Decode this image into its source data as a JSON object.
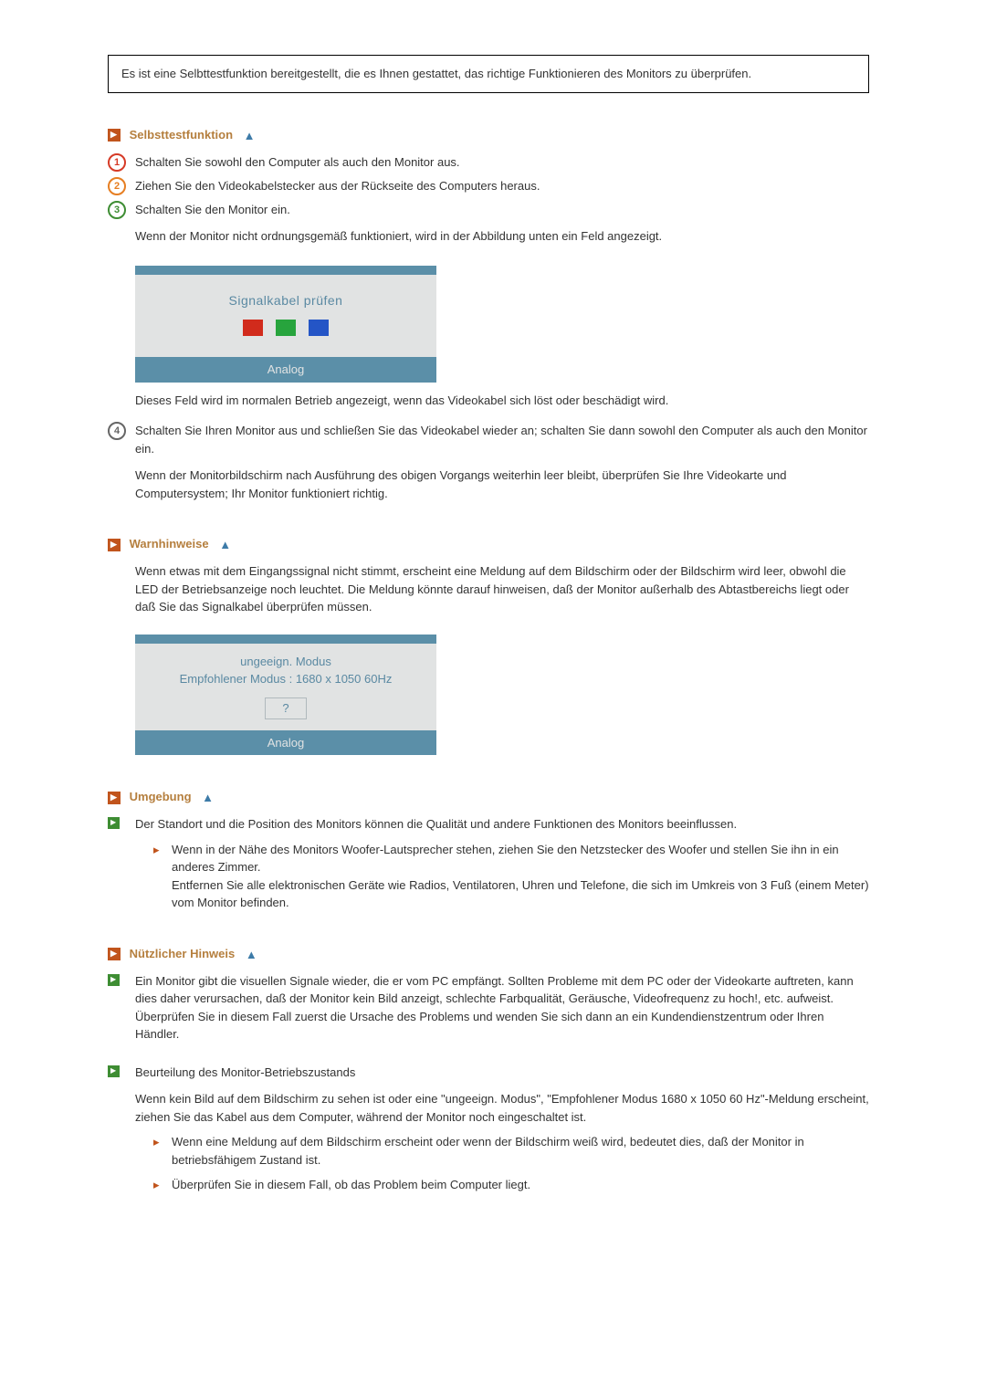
{
  "intro": "Es ist eine Selbttestfunktion bereitgestellt, die es Ihnen gestattet, das richtige Funktionieren des Monitors zu überprüfen.",
  "sec1": {
    "title": "Selbsttestfunktion",
    "items": {
      "i1": "Schalten Sie sowohl den Computer als auch den Monitor aus.",
      "i2": "Ziehen Sie den Videokabelstecker aus der Rückseite des Computers heraus.",
      "i3": "Schalten Sie den Monitor ein.",
      "i3_sub": "Wenn der Monitor nicht ordnungsgemäß funktioniert, wird in der Abbildung unten ein Feld angezeigt.",
      "osd_title": "Signalkabel prüfen",
      "osd_bottom": "Analog",
      "i3_after": "Dieses Feld wird im normalen Betrieb angezeigt, wenn das Videokabel sich löst oder beschädigt wird.",
      "i4": "Schalten Sie Ihren Monitor aus und schließen Sie das Videokabel wieder an; schalten Sie dann sowohl den Computer als auch den Monitor ein.",
      "i4_sub": "Wenn der Monitorbildschirm nach Ausführung des obigen Vorgangs weiterhin leer bleibt, überprüfen Sie Ihre Videokarte und Computersystem; Ihr Monitor funktioniert richtig."
    }
  },
  "sec2": {
    "title": "Warnhinweise",
    "body": "Wenn etwas mit dem Eingangssignal nicht stimmt, erscheint eine Meldung auf dem Bildschirm oder der Bildschirm wird leer, obwohl die LED der Betriebsanzeige noch leuchtet. Die Meldung könnte darauf hinweisen, daß der Monitor außerhalb des Abtastbereichs liegt oder daß Sie das Signalkabel überprüfen müssen.",
    "osd_line1": "ungeeign. Modus",
    "osd_line2": "Empfohlener Modus : 1680 x 1050  60Hz",
    "osd_q": "?",
    "osd_bottom": "Analog"
  },
  "sec3": {
    "title": "Umgebung",
    "g1": "Der Standort und die Position des Monitors können die Qualität und andere Funktionen des Monitors beeinflussen.",
    "r1": "Wenn in der Nähe des Monitors Woofer-Lautsprecher stehen, ziehen Sie den Netzstecker des Woofer und stellen Sie ihn in ein anderes Zimmer.",
    "r1b": "Entfernen Sie alle elektronischen Geräte wie Radios, Ventilatoren, Uhren und Telefone, die sich im Umkreis von 3 Fuß (einem Meter) vom Monitor befinden."
  },
  "sec4": {
    "title": "Nützlicher Hinweis",
    "g1": "Ein Monitor gibt die visuellen Signale wieder, die er vom PC empfängt. Sollten Probleme mit dem PC oder der Videokarte auftreten, kann dies daher verursachen, daß der Monitor kein Bild anzeigt, schlechte Farbqualität, Geräusche, Videofrequenz zu hoch!, etc. aufweist. Überprüfen Sie in diesem Fall zuerst die Ursache des Problems und wenden Sie sich dann an ein Kundendienstzentrum oder Ihren Händler.",
    "g2": "Beurteilung des Monitor-Betriebszustands",
    "g2_sub": "Wenn kein Bild auf dem Bildschirm zu sehen ist oder eine \"ungeeign. Modus\", \"Empfohlener Modus 1680 x 1050 60 Hz\"-Meldung erscheint, ziehen Sie das Kabel aus dem Computer, während der Monitor noch eingeschaltet ist.",
    "r1": "Wenn eine Meldung auf dem Bildschirm erscheint oder wenn der Bildschirm weiß wird, bedeutet dies, daß der Monitor in betriebsfähigem Zustand ist.",
    "r2": "Überprüfen Sie in diesem Fall, ob das Problem beim Computer liegt."
  }
}
